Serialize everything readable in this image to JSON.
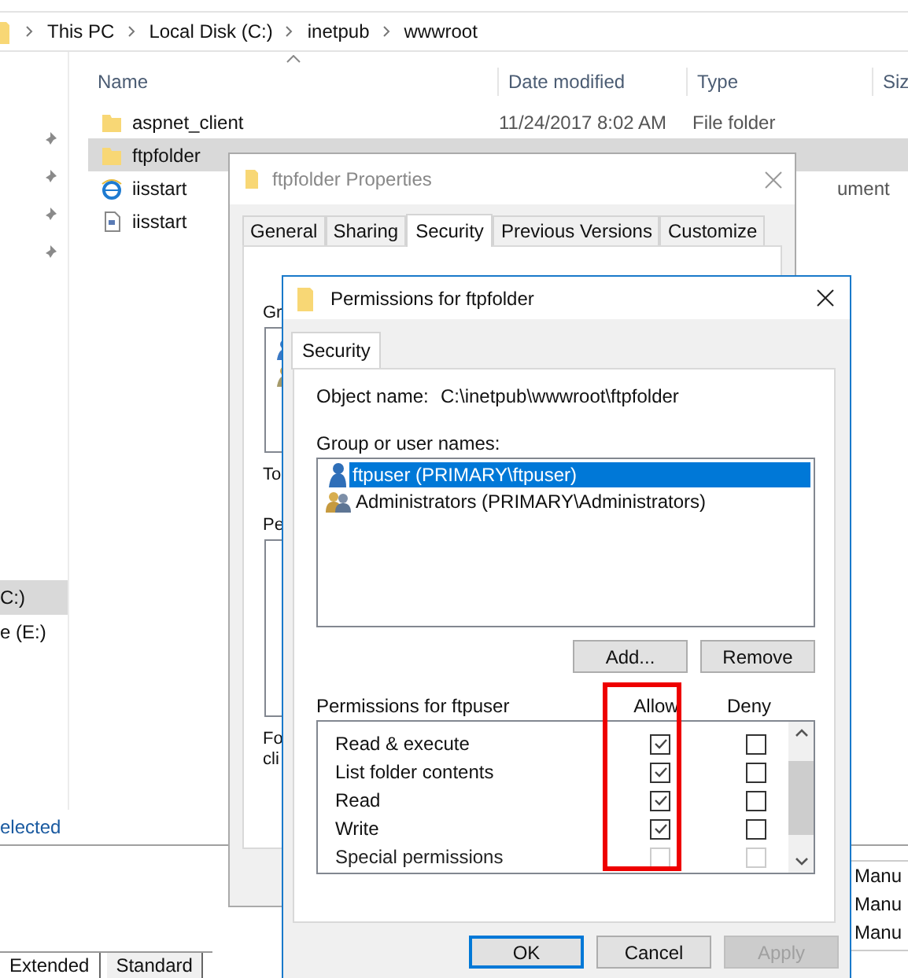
{
  "explorer": {
    "breadcrumb": [
      "This PC",
      "Local Disk (C:)",
      "inetpub",
      "wwwroot"
    ],
    "columns": [
      "Name",
      "Date modified",
      "Type",
      "Siz"
    ],
    "files": [
      {
        "kind": "folder",
        "name": "aspnet_client",
        "date": "11/24/2017 8:02 AM",
        "type": "File folder",
        "selected": false
      },
      {
        "kind": "folder",
        "name": "ftpfolder",
        "selected": true
      },
      {
        "kind": "webpage",
        "name": "iisstart",
        "type": "ument",
        "selected": false
      },
      {
        "kind": "document",
        "name": "iisstart",
        "selected": false
      }
    ],
    "nav": [
      {
        "label": "C:)",
        "selected": true
      },
      {
        "label": "e (E:)",
        "selected": false
      }
    ],
    "status": "elected"
  },
  "console": {
    "tabs": [
      {
        "label": "Extended",
        "selected": true
      },
      {
        "label": "Standard",
        "selected": false
      }
    ],
    "startup_cells": [
      "Manu",
      "Manu",
      "Manu"
    ]
  },
  "properties": {
    "title": "ftpfolder Properties",
    "tabs": [
      {
        "label": "General",
        "selected": false
      },
      {
        "label": "Sharing",
        "selected": false
      },
      {
        "label": "Security",
        "selected": true
      },
      {
        "label": "Previous Versions",
        "selected": false
      },
      {
        "label": "Customize",
        "selected": false
      }
    ],
    "group_label": "Gr",
    "principals": [
      {
        "kind": "user"
      },
      {
        "kind": "group"
      }
    ],
    "total_label": "To",
    "permissions_label": "Pe",
    "note_lines": [
      "Fo",
      "cli"
    ]
  },
  "permissions": {
    "title": "Permissions for ftpfolder",
    "tabs": [
      {
        "label": "Security",
        "selected": true
      }
    ],
    "object_label": "Object name:",
    "object_value": "C:\\inetpub\\wwwroot\\ftpfolder",
    "group_label": "Group or user names:",
    "principals": [
      {
        "kind": "user",
        "name": "ftpuser (PRIMARY\\ftpuser)",
        "selected": true
      },
      {
        "kind": "group",
        "name": "Administrators (PRIMARY\\Administrators)",
        "selected": false
      }
    ],
    "buttons": [
      "Add...",
      "Remove"
    ],
    "perm_label": "Permissions for ftpuser",
    "allow_header": "Allow",
    "deny_header": "Deny",
    "perms": [
      {
        "name": "Read & execute",
        "allow": true,
        "deny": false,
        "disabled": false
      },
      {
        "name": "List folder contents",
        "allow": true,
        "deny": false,
        "disabled": false
      },
      {
        "name": "Read",
        "allow": true,
        "deny": false,
        "disabled": false
      },
      {
        "name": "Write",
        "allow": true,
        "deny": false,
        "disabled": false
      },
      {
        "name": "Special permissions",
        "allow": false,
        "deny": false,
        "disabled": true
      }
    ],
    "dialog_buttons": [
      {
        "label": "OK",
        "default": true,
        "disabled": false
      },
      {
        "label": "Cancel",
        "default": false,
        "disabled": false
      },
      {
        "label": "Apply",
        "default": false,
        "disabled": true
      }
    ]
  }
}
